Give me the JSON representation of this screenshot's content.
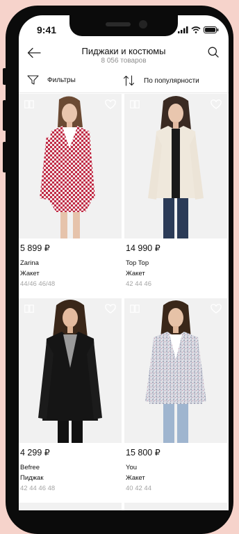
{
  "status": {
    "time": "9:41"
  },
  "header": {
    "title": "Пиджаки и костюмы",
    "subtitle": "8 056 товаров"
  },
  "filters": {
    "filter_label": "Фильтры",
    "sort_label": "По популярности"
  },
  "products": [
    {
      "price": "5 899 ₽",
      "brand": "Zarina",
      "type": "Жакет",
      "sizes": "44/46 46/48"
    },
    {
      "price": "14 990 ₽",
      "brand": "Top Top",
      "type": "Жакет",
      "sizes": "42 44 46"
    },
    {
      "price": "4 299 ₽",
      "brand": "Befree",
      "type": "Пиджак",
      "sizes": "42 44 46 48"
    },
    {
      "price": "15 800 ₽",
      "brand": "You",
      "type": "Жакет",
      "sizes": "40 42 44"
    }
  ],
  "colors": {
    "background": "#f6d3cb",
    "device": "#0b0b0b",
    "muted_text": "#8d8d8d",
    "sizes_text": "#a4a4a4"
  },
  "icons": {
    "back": "arrow-left-icon",
    "search": "search-icon",
    "filter": "filter-funnel-icon",
    "sort": "sort-arrows-icon",
    "compare": "compare-icon",
    "favorite": "heart-icon"
  }
}
